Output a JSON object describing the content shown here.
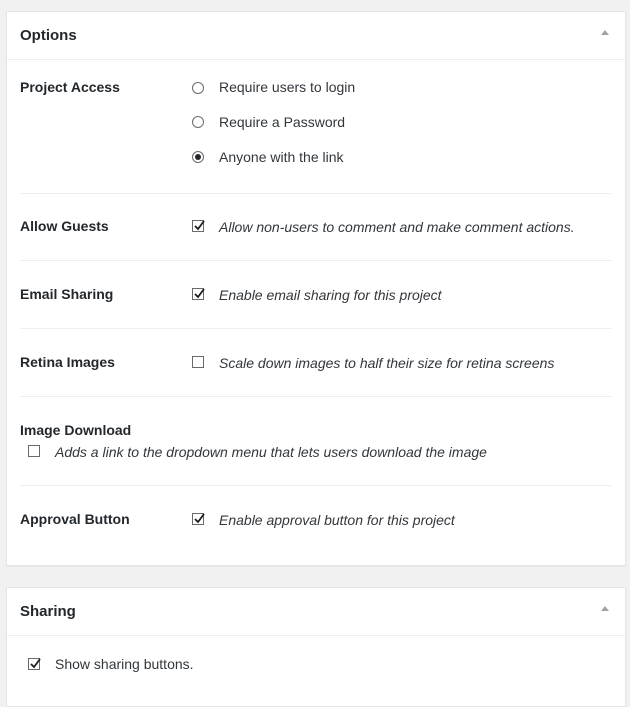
{
  "options": {
    "title": "Options",
    "project_access": {
      "label": "Project Access",
      "choices": [
        {
          "label": "Require users to login",
          "selected": false
        },
        {
          "label": "Require a Password",
          "selected": false
        },
        {
          "label": "Anyone with the link",
          "selected": true
        }
      ]
    },
    "allow_guests": {
      "label": "Allow Guests",
      "checked": true,
      "description": "Allow non-users to comment and make comment actions."
    },
    "email_sharing": {
      "label": "Email Sharing",
      "checked": true,
      "description": "Enable email sharing for this project"
    },
    "retina_images": {
      "label": "Retina Images",
      "checked": false,
      "description": "Scale down images to half their size for retina screens"
    },
    "image_download": {
      "label": "Image Download",
      "checked": false,
      "description": "Adds a link to the dropdown menu that lets users download the image"
    },
    "approval_button": {
      "label": "Approval Button",
      "checked": true,
      "description": "Enable approval button for this project"
    }
  },
  "sharing": {
    "title": "Sharing",
    "show_buttons": {
      "checked": true,
      "label": "Show sharing buttons."
    }
  }
}
